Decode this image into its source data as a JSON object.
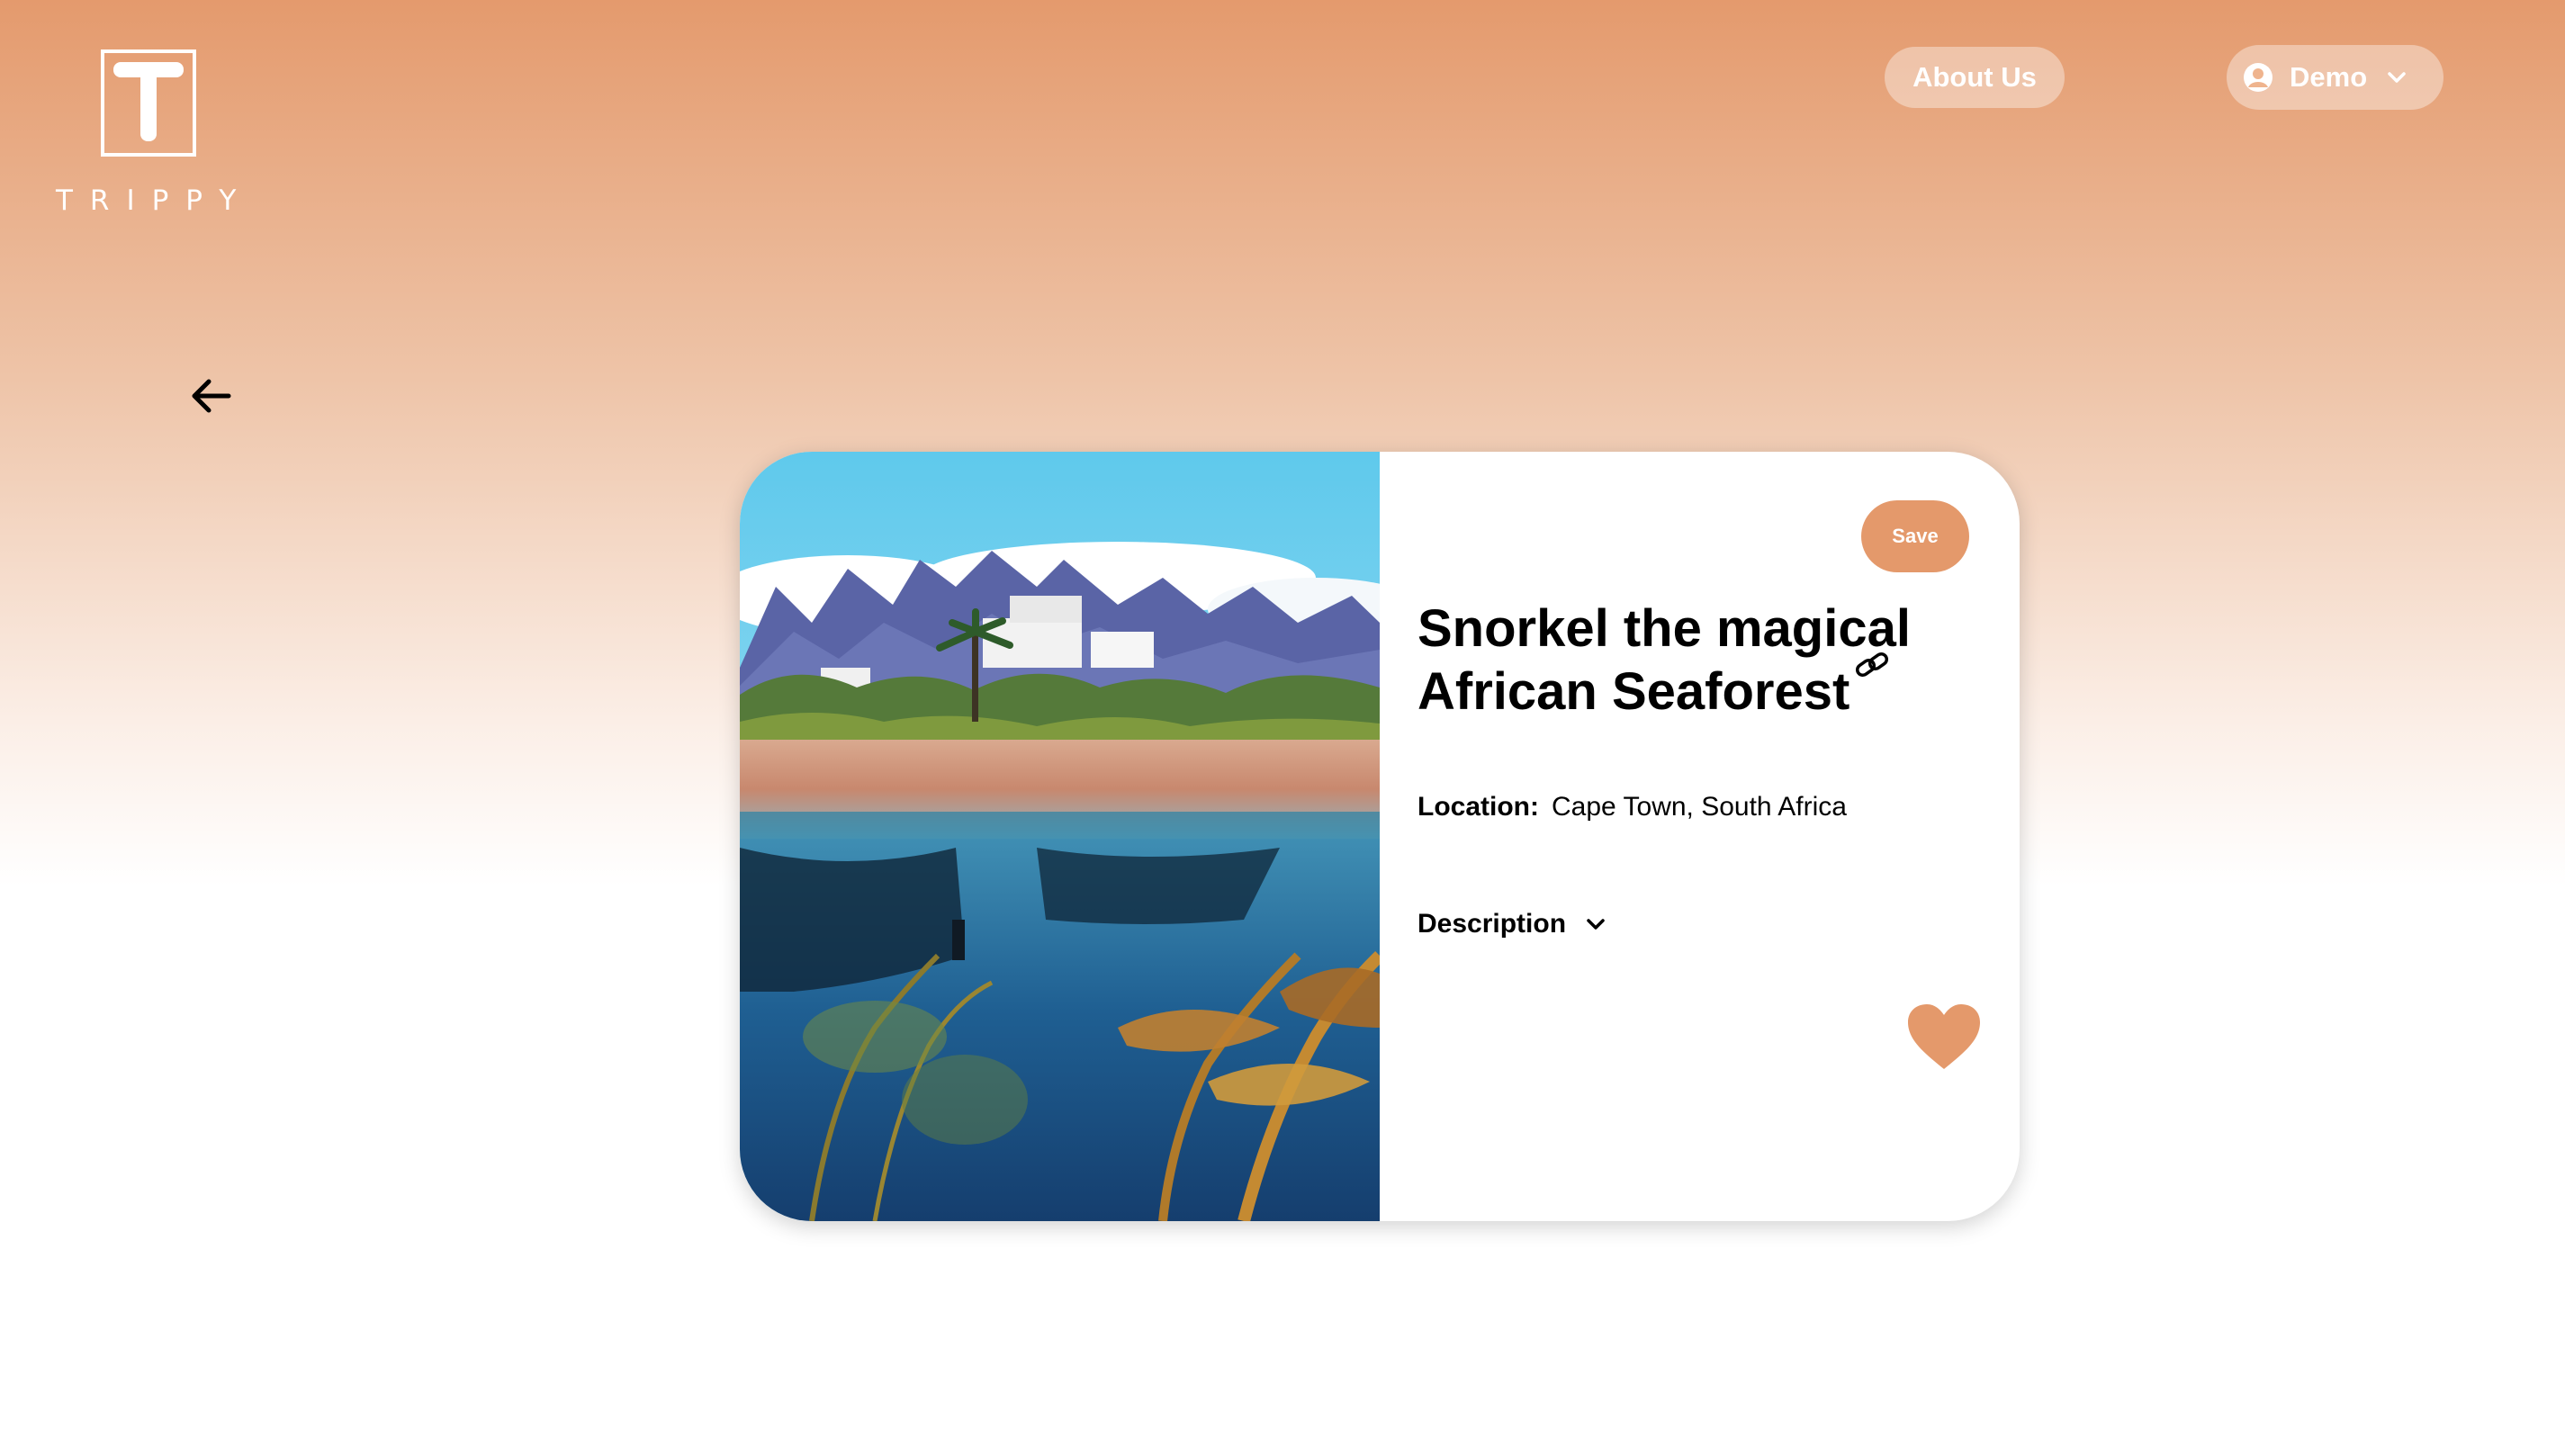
{
  "header": {
    "logo_word": "TRIPPY",
    "nav": {
      "about_label": "About Us",
      "user_label": "Demo"
    }
  },
  "activity": {
    "save_label": "Save",
    "title": "Snorkel the magical African Seaforest",
    "location_label": "Location:",
    "location_value": "Cape Town, South Africa",
    "description_label": "Description"
  },
  "icons": {
    "back": "arrow-left-icon",
    "user": "user-circle-icon",
    "dropdown": "chevron-down-icon",
    "link": "link-icon",
    "favorite": "heart-icon"
  },
  "colors": {
    "accent": "#e4996b",
    "header_top": "#e49a6d",
    "text": "#000000",
    "card": "#ffffff"
  }
}
